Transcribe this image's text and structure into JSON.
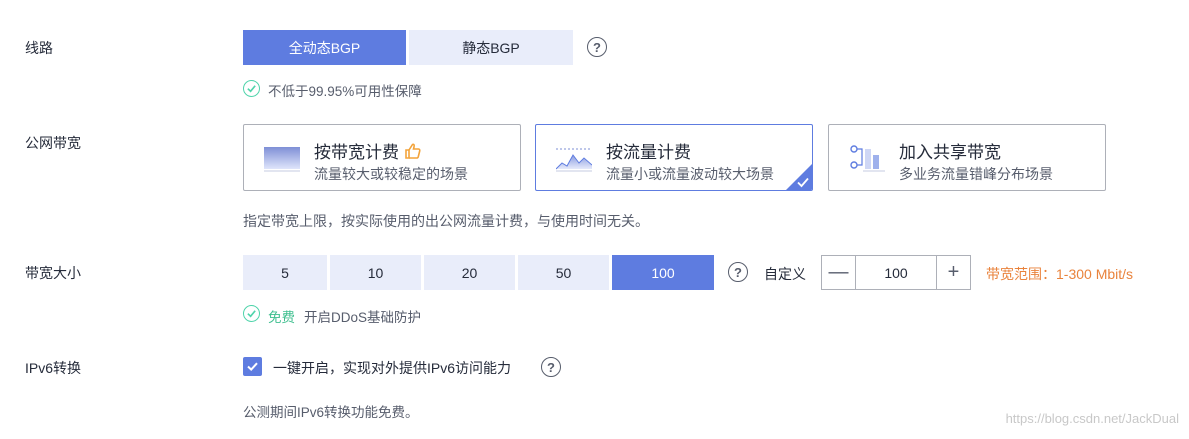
{
  "labels": {
    "line": "线路",
    "bandwidth_type": "公网带宽",
    "bandwidth_size": "带宽大小",
    "ipv6": "IPv6转换"
  },
  "line": {
    "options": [
      "全动态BGP",
      "静态BGP"
    ],
    "selected": "全动态BGP",
    "guarantee": "不低于99.95%可用性保障"
  },
  "bandwidth_cards": [
    {
      "title": "按带宽计费",
      "desc": "流量较大或较稳定的场景",
      "badge_icon": "thumbs-up-icon"
    },
    {
      "title": "按流量计费",
      "desc": "流量小或流量波动较大场景",
      "selected": true
    },
    {
      "title": "加入共享带宽",
      "desc": "多业务流量错峰分布场景"
    }
  ],
  "bandwidth_note": "指定带宽上限，按实际使用的出公网流量计费，与使用时间无关。",
  "bandwidth_size": {
    "options": [
      "5",
      "10",
      "20",
      "50",
      "100"
    ],
    "selected": "100",
    "custom_label": "自定义",
    "value": "100",
    "range": "带宽范围：1-300 Mbit/s",
    "free_label": "免费",
    "ddos_text": "开启DDoS基础防护"
  },
  "ipv6": {
    "checked": true,
    "label": "一键开启，实现对外提供IPv6访问能力",
    "note": "公测期间IPv6转换功能免费。"
  },
  "watermark": "https://blog.csdn.net/JackDual",
  "colors": {
    "accent": "#5e7ce0",
    "inactive_bg": "#e9edfa",
    "success": "#50d4ab",
    "range_text": "#e9833c",
    "thumb": "#f3a33a"
  }
}
